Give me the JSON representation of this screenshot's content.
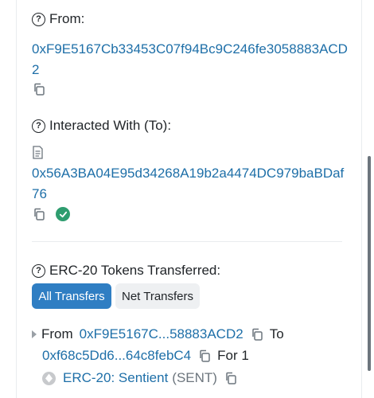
{
  "from_section": {
    "label": "From:",
    "address": "0xF9E5167Cb33453C07f94Bc9C246fe3058883ACD2"
  },
  "to_section": {
    "label": "Interacted With (To):",
    "address": "0x56A3BA04E95d34268A19b2a4474DC979baBDaf76"
  },
  "tokens_section": {
    "label": "ERC-20 Tokens Transferred:",
    "tabs": [
      "All Transfers",
      "Net Transfers"
    ],
    "active_tab": "All Transfers",
    "transfer": {
      "from_word": "From",
      "from_address": "0xF9E5167C...58883ACD2",
      "to_word": "To",
      "to_address": "0xf68c5Dd6...64c8febC4",
      "for_text": "For 1",
      "token_name": "ERC-20: Sentient",
      "token_symbol": "(SENT)"
    }
  },
  "icons": {
    "help": "question-circle-icon",
    "copy": "copy-icon",
    "contract": "document-icon",
    "verified": "check-circle-icon",
    "expand": "caret-right-icon",
    "token": "ethereum-token-icon"
  },
  "colors": {
    "link": "#1e6fa8",
    "primary_button": "#2f7ec3",
    "verified": "#2e9d6f"
  }
}
